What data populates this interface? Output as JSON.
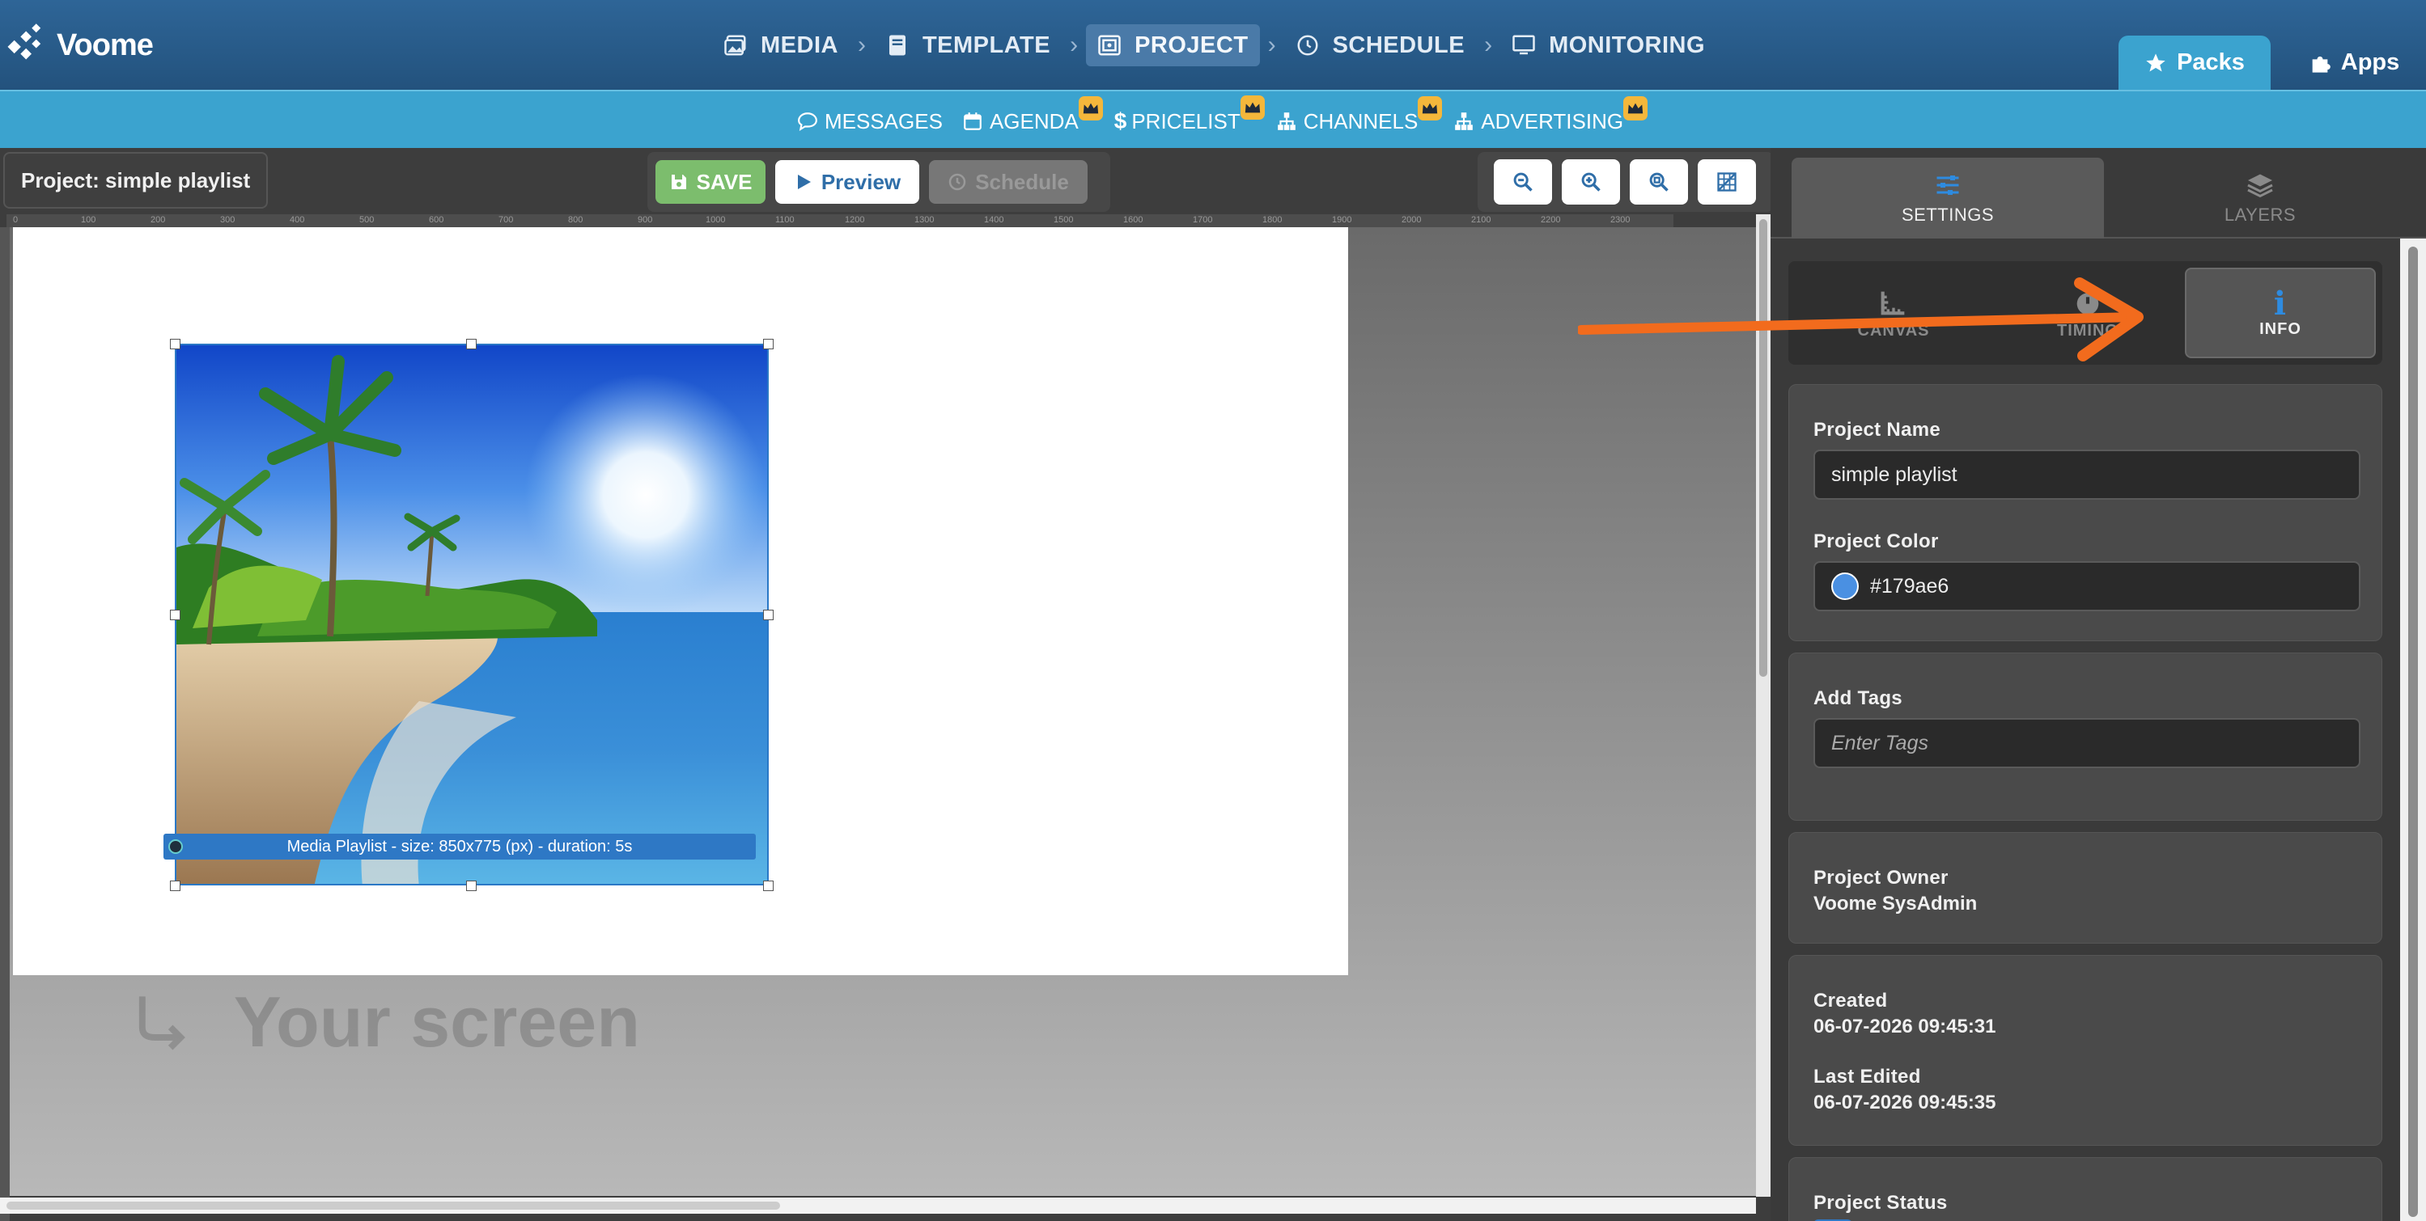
{
  "app": {
    "logo_text": "Voome"
  },
  "main_nav": [
    {
      "label": "MEDIA",
      "icon": "image-icon"
    },
    {
      "label": "TEMPLATE",
      "icon": "book-icon"
    },
    {
      "label": "PROJECT",
      "icon": "project-icon",
      "active": true
    },
    {
      "label": "SCHEDULE",
      "icon": "clock-icon"
    },
    {
      "label": "MONITORING",
      "icon": "monitor-icon"
    }
  ],
  "top_right": {
    "packs": "Packs",
    "apps": "Apps"
  },
  "sub_nav": [
    {
      "label": "MESSAGES",
      "icon": "chat-icon",
      "premium": false
    },
    {
      "label": "AGENDA",
      "icon": "calendar-icon",
      "premium": true
    },
    {
      "label": "PRICELIST",
      "icon": "dollar-icon",
      "premium": true
    },
    {
      "label": "CHANNELS",
      "icon": "sitemap-icon",
      "premium": true
    },
    {
      "label": "ADVERTISING",
      "icon": "sitemap-icon",
      "premium": true
    }
  ],
  "editor": {
    "project_label": "Project: simple playlist",
    "save": "SAVE",
    "preview": "Preview",
    "schedule": "Schedule",
    "ruler_ticks": [
      "0",
      "100",
      "200",
      "300",
      "400",
      "500",
      "600",
      "700",
      "800",
      "900",
      "1000",
      "1100",
      "1200",
      "1300",
      "1400",
      "1500",
      "1600",
      "1700",
      "1800",
      "1900",
      "2000",
      "2100",
      "2200",
      "2300"
    ],
    "media_caption": "Media Playlist - size: 850x775 (px) - duration: 5s",
    "your_screen": "Your screen"
  },
  "panel": {
    "tabs": {
      "settings": "SETTINGS",
      "layers": "LAYERS"
    },
    "subtabs": {
      "canvas": "CANVAS",
      "timing": "TIMING",
      "info": "INFO"
    },
    "project_name_label": "Project Name",
    "project_name_value": "simple playlist",
    "project_color_label": "Project Color",
    "project_color_value": "#179ae6",
    "add_tags_label": "Add Tags",
    "add_tags_placeholder": "Enter Tags",
    "owner_label": "Project Owner",
    "owner_value": "Voome SysAdmin",
    "created_label": "Created",
    "created_value": "06-07-2026 09:45:31",
    "edited_label": "Last Edited",
    "edited_value": "06-07-2026 09:45:35",
    "status_label": "Project Status"
  },
  "colors": {
    "accent": "#3ba3cf",
    "nav": "#2a5e8c",
    "annotation_arrow": "#f26b1d",
    "project_color": "#179ae6"
  }
}
